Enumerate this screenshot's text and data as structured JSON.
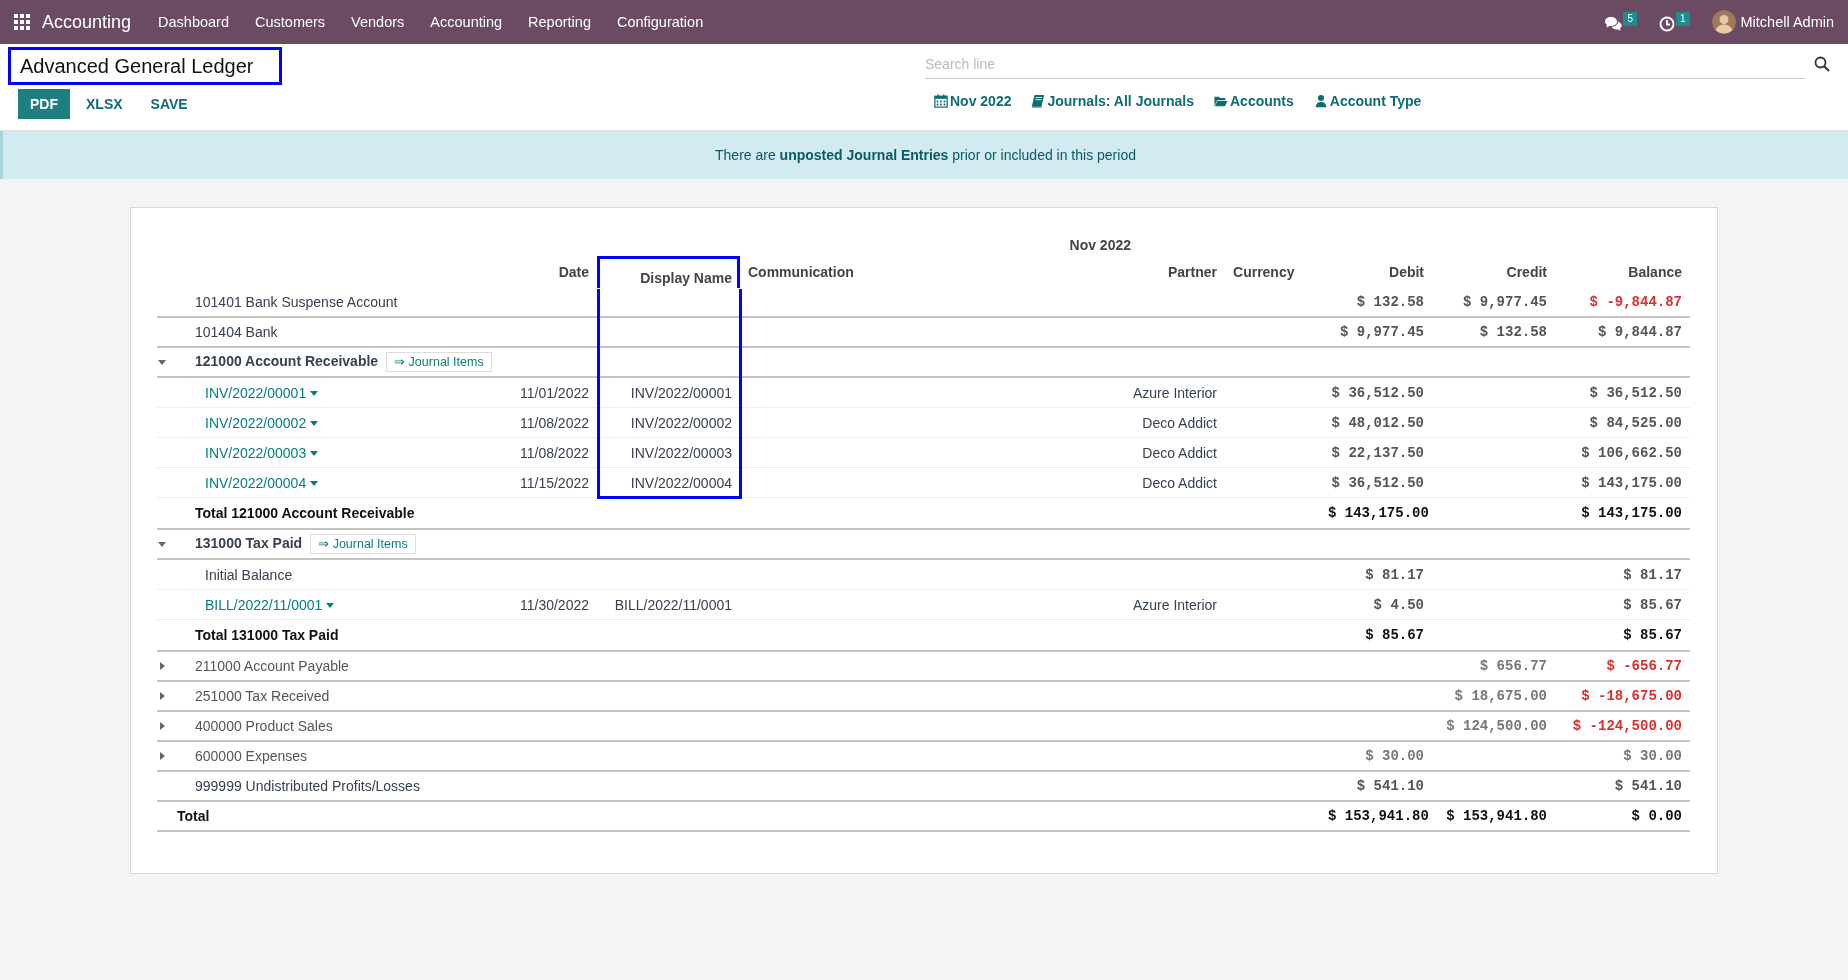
{
  "navbar": {
    "app_name": "Accounting",
    "menu": [
      "Dashboard",
      "Customers",
      "Vendors",
      "Accounting",
      "Reporting",
      "Configuration"
    ],
    "messages_badge": "5",
    "activities_badge": "1",
    "user_name": "Mitchell Admin"
  },
  "title": {
    "text": "Advanced General Ledger",
    "highlighted": true
  },
  "actions": [
    {
      "label": "PDF",
      "primary": true
    },
    {
      "label": "XLSX",
      "primary": false
    },
    {
      "label": "SAVE",
      "primary": false
    }
  ],
  "search": {
    "placeholder": "Search line"
  },
  "filters": [
    {
      "kind": "calendar",
      "label": "Nov 2022"
    },
    {
      "kind": "book",
      "label": "Journals: All Journals"
    },
    {
      "kind": "folder",
      "label": "Accounts"
    },
    {
      "kind": "user",
      "label": "Account Type"
    }
  ],
  "alert": "There are **unposted Journal Entries** prior or included in this period",
  "table": {
    "period": "Nov 2022",
    "columns": [
      {
        "label": "Date",
        "highlighted": false
      },
      {
        "label": "Display Name",
        "highlighted": true
      },
      {
        "label": "Communication",
        "highlighted": false
      },
      {
        "label": "Partner",
        "highlighted": false
      },
      {
        "label": "Currency",
        "highlighted": false
      },
      {
        "label": "Debit",
        "highlighted": false
      },
      {
        "label": "Credit",
        "highlighted": false
      },
      {
        "label": "Balance",
        "highlighted": false
      }
    ],
    "accounts": [
      {
        "name": "101401 Bank Suspense Account",
        "debit": "$ 132.58",
        "credit": "$ 9,977.45",
        "balance": "$ -9,844.87",
        "negative": true
      },
      {
        "name": "101404 Bank",
        "debit": "$ 9,977.45",
        "credit": "$ 132.58",
        "balance": "$ 9,844.87",
        "negative": false
      },
      {
        "name": "121000 Account Receivable",
        "expanded": true,
        "journal_items": "⇒ Journal Items",
        "lines": [
          {
            "kind": "entry",
            "name": "INV/2022/00001",
            "date": "11/01/2022",
            "display_name": "INV/2022/00001",
            "partner": "Azure Interior",
            "debit": "$ 36,512.50",
            "balance": "$ 36,512.50",
            "highlighted": true
          },
          {
            "kind": "entry",
            "name": "INV/2022/00002",
            "date": "11/08/2022",
            "display_name": "INV/2022/00002",
            "partner": "Deco Addict",
            "debit": "$ 48,012.50",
            "balance": "$ 84,525.00",
            "highlighted": true
          },
          {
            "kind": "entry",
            "name": "INV/2022/00003",
            "date": "11/08/2022",
            "display_name": "INV/2022/00003",
            "partner": "Deco Addict",
            "debit": "$ 22,137.50",
            "balance": "$ 106,662.50",
            "highlighted": true
          },
          {
            "kind": "entry",
            "name": "INV/2022/00004",
            "date": "11/15/2022",
            "display_name": "INV/2022/00004",
            "partner": "Deco Addict",
            "debit": "$ 36,512.50",
            "balance": "$ 143,175.00",
            "highlighted": true
          }
        ],
        "total": {
          "label": "Total 121000 Account Receivable",
          "debit": "$ 143,175.00",
          "balance": "$ 143,175.00"
        }
      },
      {
        "name": "131000 Tax Paid",
        "expanded": true,
        "journal_items": "⇒ Journal Items",
        "lines": [
          {
            "kind": "initial",
            "name": "Initial Balance",
            "debit": "$ 81.17",
            "balance": "$ 81.17",
            "highlighted": false
          },
          {
            "kind": "entry",
            "name": "BILL/2022/11/0001",
            "date": "11/30/2022",
            "display_name": "BILL/2022/11/0001",
            "partner": "Azure Interior",
            "debit": "$ 4.50",
            "balance": "$ 85.67",
            "highlighted": false
          }
        ],
        "total": {
          "label": "Total 131000 Tax Paid",
          "debit": "$ 85.67",
          "balance": "$ 85.67"
        }
      },
      {
        "name": "211000 Account Payable",
        "expanded": false,
        "credit": "$ 656.77",
        "balance": "$ -656.77",
        "negative": true
      },
      {
        "name": "251000 Tax Received",
        "expanded": false,
        "credit": "$ 18,675.00",
        "balance": "$ -18,675.00",
        "negative": true
      },
      {
        "name": "400000 Product Sales",
        "expanded": false,
        "credit": "$ 124,500.00",
        "balance": "$ -124,500.00",
        "negative": true
      },
      {
        "name": "600000 Expenses",
        "expanded": false,
        "debit": "$ 30.00",
        "balance": "$ 30.00",
        "negative": false
      },
      {
        "name": "999999 Undistributed Profits/Losses",
        "debit": "$ 541.10",
        "balance": "$ 541.10",
        "negative": false
      }
    ],
    "grand_total": {
      "label": "Total",
      "debit": "$ 153,941.80",
      "credit": "$ 153,941.80",
      "balance": "$ 0.00"
    }
  }
}
